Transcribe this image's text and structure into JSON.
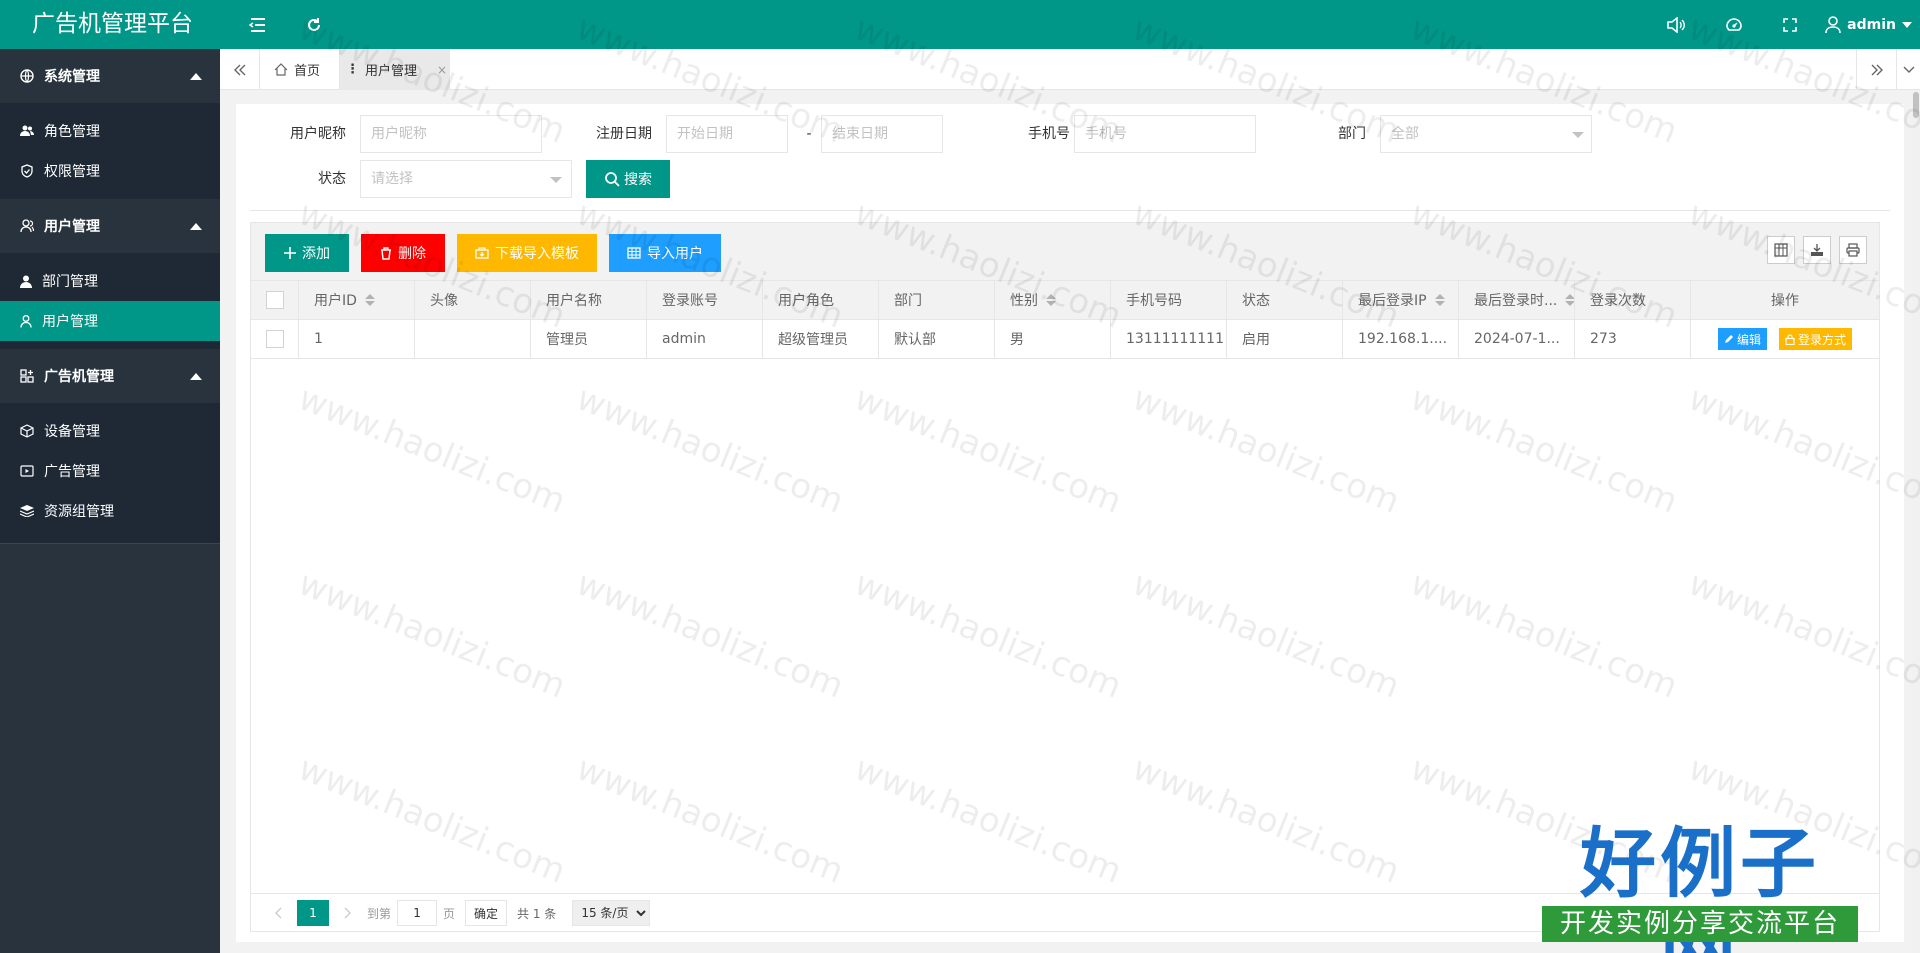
{
  "app": {
    "title": "广告机管理平台",
    "user": "admin"
  },
  "sidebar": {
    "groups": [
      {
        "label": "系统管理",
        "items": [
          "角色管理",
          "权限管理"
        ]
      },
      {
        "label": "用户管理",
        "items": [
          "部门管理",
          "用户管理"
        ],
        "active": "用户管理"
      },
      {
        "label": "广告机管理",
        "items": [
          "设备管理",
          "广告管理",
          "资源组管理"
        ]
      }
    ]
  },
  "tabs": {
    "home": "首页",
    "current": "用户管理",
    "close": "×"
  },
  "search": {
    "nickname_label": "用户昵称",
    "nickname_placeholder": "用户昵称",
    "date_label": "注册日期",
    "start_placeholder": "开始日期",
    "date_sep": "-",
    "end_placeholder": "结束日期",
    "phone_label": "手机号",
    "phone_placeholder": "手机号",
    "dept_label": "部门",
    "dept_value": "全部",
    "status_label": "状态",
    "status_placeholder": "请选择",
    "search_btn": "搜索"
  },
  "toolbar": {
    "add": "添加",
    "delete": "删除",
    "download": "下载导入模板",
    "import": "导入用户"
  },
  "table": {
    "headers": [
      "用户ID",
      "头像",
      "用户名称",
      "登录账号",
      "用户角色",
      "部门",
      "性别",
      "手机号码",
      "状态",
      "最后登录IP",
      "最后登录时...",
      "登录次数",
      "操作"
    ],
    "rows": [
      {
        "id": "1",
        "avatar": "",
        "name": "管理员",
        "account": "admin",
        "role": "超级管理员",
        "dept": "默认部",
        "gender": "男",
        "phone": "13111111111",
        "status": "启用",
        "ip": "192.168.1....",
        "time": "2024-07-1...",
        "count": "273",
        "edit": "编辑",
        "login_method": "登录方式"
      }
    ]
  },
  "pager": {
    "current": "1",
    "goto": "到第",
    "page_input": "1",
    "page_unit": "页",
    "confirm": "确定",
    "total": "共 1 条",
    "per_page": "15 条/页"
  },
  "watermark": "www.haolizi.com",
  "brand": {
    "title": "好例子网",
    "subtitle": "开发实例分享交流平台"
  },
  "colors": {
    "primary": "#009688",
    "sidebar": "#28333e",
    "danger": "#ff0000",
    "warning": "#ffb800",
    "info": "#1e9fff"
  }
}
